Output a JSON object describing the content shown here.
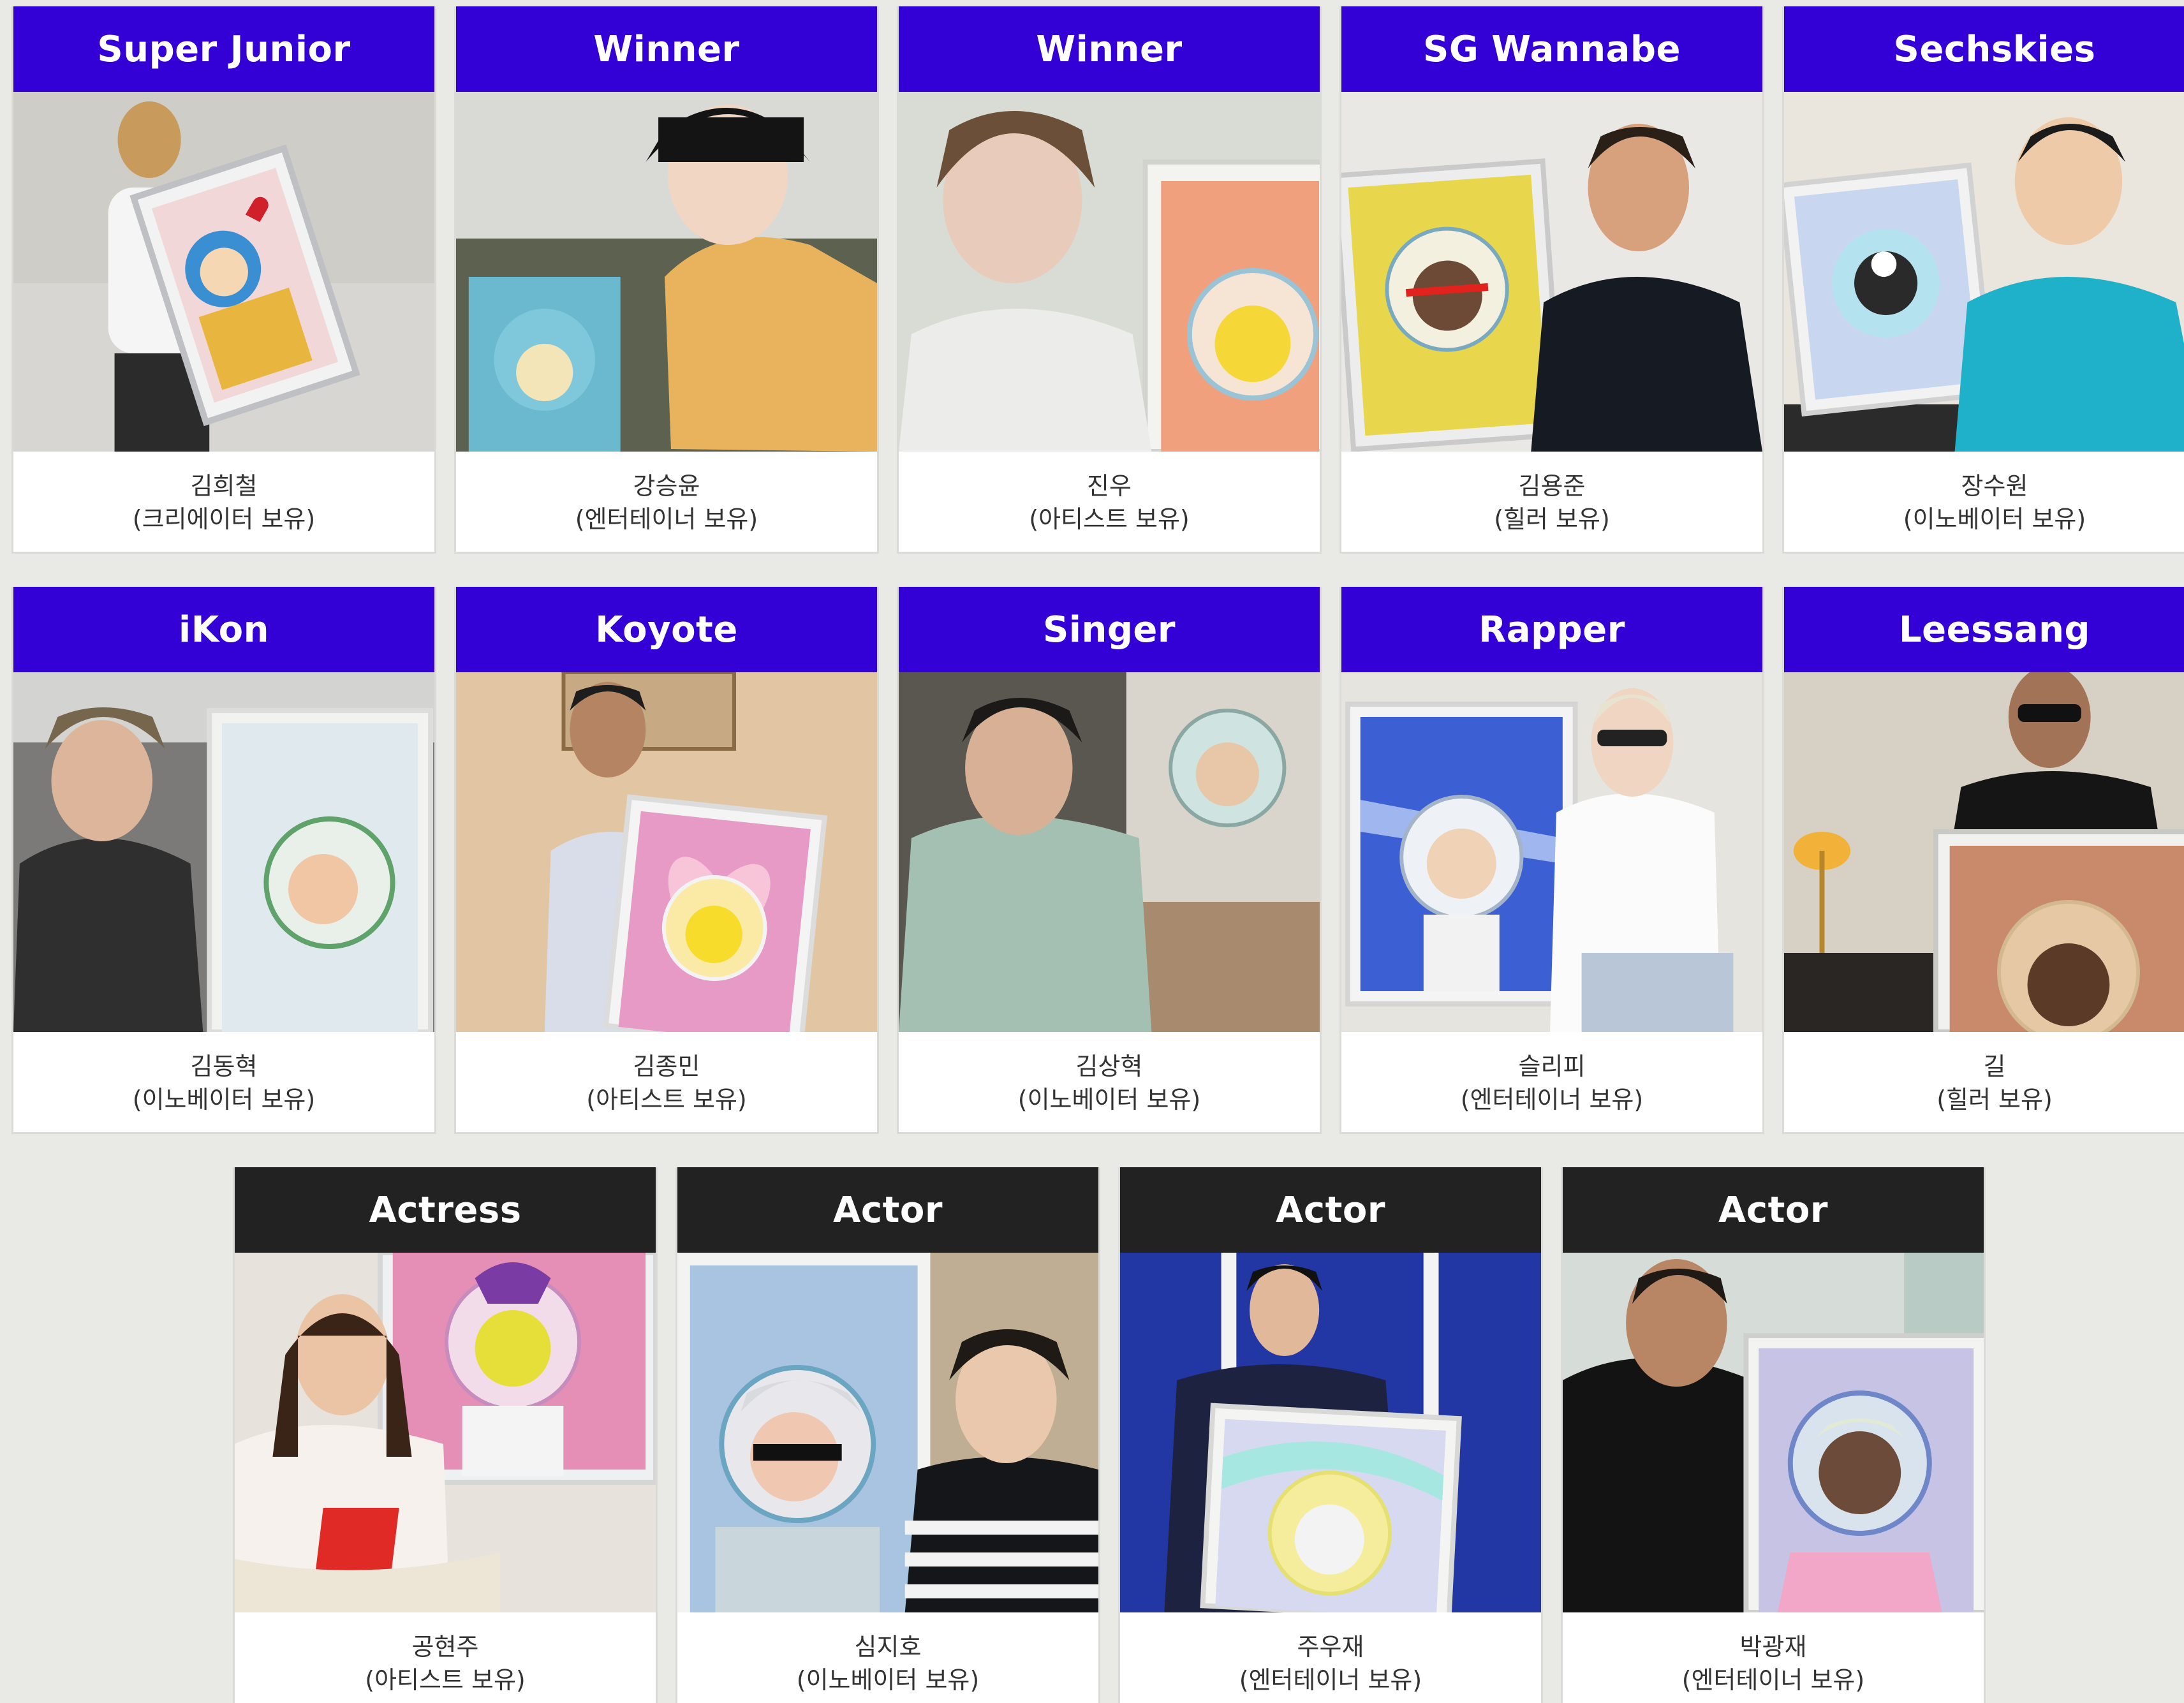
{
  "cards": [
    {
      "group": "Super Junior",
      "name": "김희철",
      "role": "(크리에이터 보유)"
    },
    {
      "group": "Winner",
      "name": "강승윤",
      "role": "(엔터테이너 보유)"
    },
    {
      "group": "Winner",
      "name": "진우",
      "role": "(아티스트 보유)"
    },
    {
      "group": "SG Wannabe",
      "name": "김용준",
      "role": "(힐러 보유)"
    },
    {
      "group": "Sechskies",
      "name": "장수원",
      "role": "(이노베이터 보유)"
    },
    {
      "group": "iKon",
      "name": "김동혁",
      "role": "(이노베이터 보유)"
    },
    {
      "group": "Koyote",
      "name": "김종민",
      "role": "(아티스트 보유)"
    },
    {
      "group": "Singer",
      "name": "김상혁",
      "role": "(이노베이터 보유)"
    },
    {
      "group": "Rapper",
      "name": "슬리피",
      "role": "(엔터테이너 보유)"
    },
    {
      "group": "Leessang",
      "name": "길",
      "role": "(힐러 보유)"
    },
    {
      "group": "Actress",
      "name": "공현주",
      "role": "(아티스트 보유)"
    },
    {
      "group": "Actor",
      "name": "심지호",
      "role": "(이노베이터 보유)"
    },
    {
      "group": "Actor",
      "name": "주우재",
      "role": "(엔터테이너 보유)"
    },
    {
      "group": "Actor",
      "name": "박광재",
      "role": "(엔터테이너 보유)"
    }
  ],
  "colors": {
    "header_blue": "#3300d6",
    "header_dark": "#222222",
    "background": "#e9e9e6"
  }
}
